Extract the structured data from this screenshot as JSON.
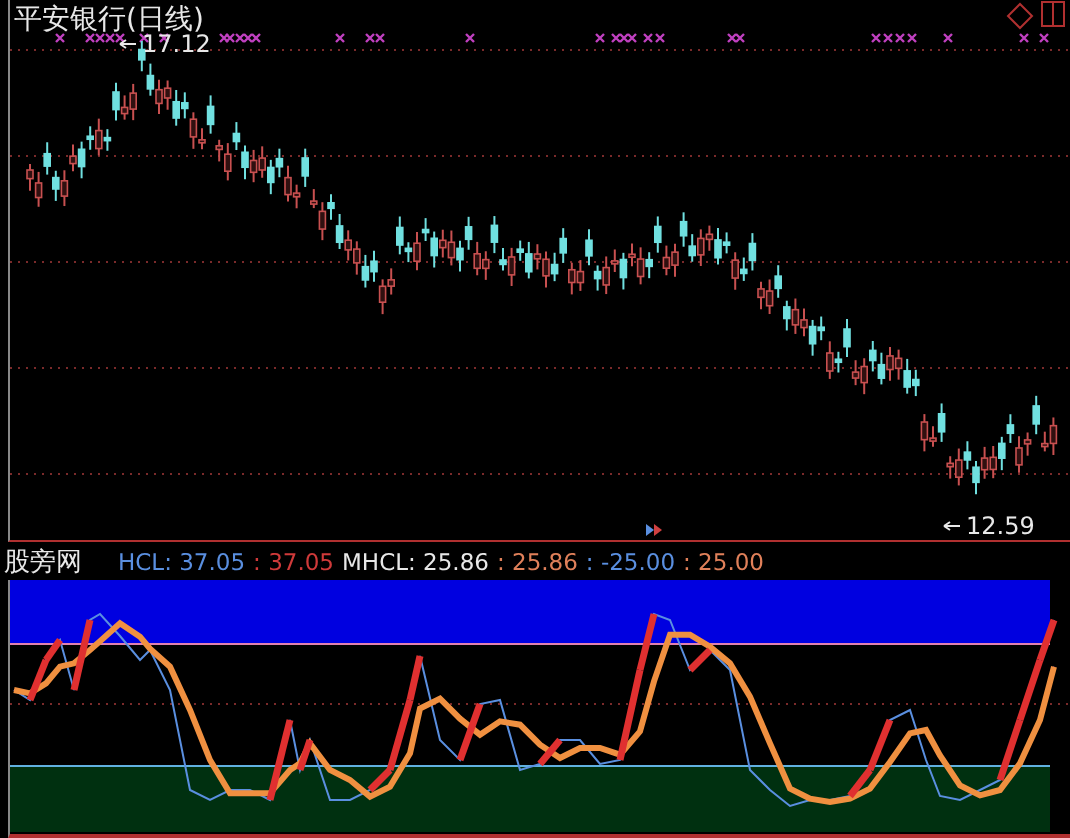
{
  "chart": {
    "title": "平安银行(日线)",
    "high_label": "17.12",
    "low_label": "12.59"
  },
  "indicator": {
    "name": "股旁网",
    "legend": [
      {
        "text": "HCL: 37.05",
        "color": "#5a8fe0"
      },
      {
        "text": ": 37.05",
        "color": "#d03a3a"
      },
      {
        "text": "MHCL: 25.86",
        "color": "#e8e8e8"
      },
      {
        "text": ": 25.86",
        "color": "#e0805a"
      },
      {
        "text": ": -25.00",
        "color": "#5a8fe0"
      },
      {
        "text": ": 25.00",
        "color": "#e0805a"
      }
    ]
  }
}
